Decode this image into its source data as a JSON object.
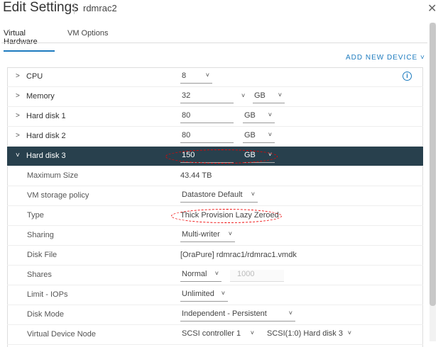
{
  "header": {
    "title": "Edit Settings",
    "vm_name": "rdmrac2"
  },
  "tabs": [
    {
      "label": "Virtual Hardware"
    },
    {
      "label": "VM Options"
    }
  ],
  "add_new_device": "ADD NEW DEVICE",
  "devices": [
    {
      "label": "CPU",
      "value": "8"
    },
    {
      "label": "Memory",
      "value": "32",
      "unit": "GB"
    },
    {
      "label": "Hard disk 1",
      "value": "80",
      "unit": "GB"
    },
    {
      "label": "Hard disk 2",
      "value": "80",
      "unit": "GB"
    },
    {
      "label": "Hard disk 3",
      "value": "150",
      "unit": "GB"
    }
  ],
  "disk3": {
    "max_size": {
      "label": "Maximum Size",
      "value": "43.44 TB"
    },
    "storage_policy": {
      "label": "VM storage policy",
      "value": "Datastore Default"
    },
    "type": {
      "label": "Type",
      "value": "Thick Provision Lazy Zeroed"
    },
    "sharing": {
      "label": "Sharing",
      "value": "Multi-writer"
    },
    "disk_file": {
      "label": "Disk File",
      "value": "[OraPure] rdmrac1/rdmrac1.vmdk"
    },
    "shares": {
      "label": "Shares",
      "value": "Normal",
      "amount": "1000"
    },
    "limit": {
      "label": "Limit - IOPs",
      "value": "Unlimited"
    },
    "disk_mode": {
      "label": "Disk Mode",
      "value": "Independent - Persistent"
    },
    "vdn": {
      "label": "Virtual Device Node",
      "controller": "SCSI controller 1",
      "node": "SCSI(1:0) Hard disk 3"
    }
  }
}
